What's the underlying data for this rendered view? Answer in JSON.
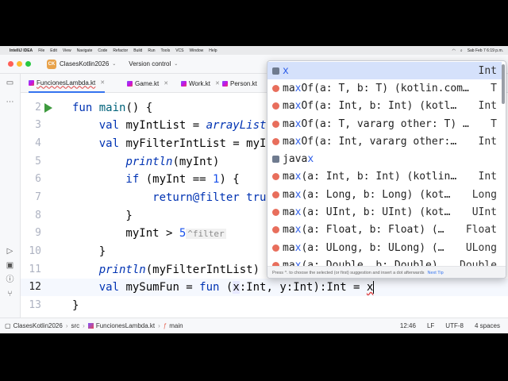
{
  "menubar": {
    "app": "IntelliJ IDEA",
    "items": [
      "File",
      "Edit",
      "View",
      "Navigate",
      "Code",
      "Refactor",
      "Build",
      "Run",
      "Tools",
      "VCS",
      "Window",
      "Help"
    ],
    "clock": "Sab Feb 7  6:19 p.m."
  },
  "titlebar": {
    "project_badge": "CK",
    "project_name": "ClasesKotlin2026",
    "version_control": "Version control"
  },
  "tabs": [
    {
      "label": "FuncionesLambda.kt",
      "active": true
    },
    {
      "label": "Game.kt",
      "active": false
    },
    {
      "label": "Work.kt",
      "active": false
    },
    {
      "label": "Person.kt",
      "active": false
    }
  ],
  "editor": {
    "line_numbers": [
      "2",
      "3",
      "4",
      "5",
      "6",
      "7",
      "8",
      "9",
      "10",
      "11",
      "12",
      "13"
    ],
    "current_line": "12",
    "lines": {
      "l2_a": "fun ",
      "l2_b": "main",
      "l2_c": "() {",
      "l3_a": "    val ",
      "l3_b": "myIntList = ",
      "l3_c": "arrayList",
      "l4_a": "    val ",
      "l4_b": "myFilterIntList = myI",
      "l5_a": "        ",
      "l5_b": "println",
      "l5_c": "(myInt)",
      "l6_a": "        if ",
      "l6_b": "(myInt == ",
      "l6_c": "1",
      "l6_d": ") {",
      "l7_a": "            return",
      "l7_b": "@filter",
      "l7_c": " tru",
      "l8_a": "        }",
      "l9_a": "        myInt > ",
      "l9_b": "5",
      "l9_hint": "^filter",
      "l10_a": "    }",
      "l11_a": "    ",
      "l11_b": "println",
      "l11_c": "(myFilterIntList)",
      "l12_a": "    val ",
      "l12_b": "mySumFun = ",
      "l12_c": "fun ",
      "l12_d": "(",
      "l12_e": "x",
      "l12_f": ":Int, ",
      "l12_g": "y",
      "l12_h": ":Int):Int = ",
      "l12_i": "x",
      "l13_a": "}"
    }
  },
  "autocomplete": {
    "items": [
      {
        "icon": "p",
        "pre": "",
        "hl": "x",
        "post": "",
        "type": "Int",
        "selected": true
      },
      {
        "icon": "m",
        "pre": "ma",
        "hl": "x",
        "post": "Of(a: T, b: T) (kotlin.com…",
        "type": "T"
      },
      {
        "icon": "m",
        "pre": "ma",
        "hl": "x",
        "post": "Of(a: Int, b: Int) (kotl…",
        "type": "Int"
      },
      {
        "icon": "m",
        "pre": "ma",
        "hl": "x",
        "post": "Of(a: T, vararg other: T) …",
        "type": "T"
      },
      {
        "icon": "m",
        "pre": "ma",
        "hl": "x",
        "post": "Of(a: Int, vararg other:…",
        "type": "Int"
      },
      {
        "icon": "p",
        "pre": "java",
        "hl": "x",
        "post": "",
        "type": ""
      },
      {
        "icon": "m",
        "pre": "ma",
        "hl": "x",
        "post": "(a: Int, b: Int) (kotlin…",
        "type": "Int"
      },
      {
        "icon": "m",
        "pre": "ma",
        "hl": "x",
        "post": "(a: Long, b: Long) (kot…",
        "type": "Long"
      },
      {
        "icon": "m",
        "pre": "ma",
        "hl": "x",
        "post": "(a: UInt, b: UInt) (kot…",
        "type": "UInt"
      },
      {
        "icon": "m",
        "pre": "ma",
        "hl": "x",
        "post": "(a: Float, b: Float) (…",
        "type": "Float"
      },
      {
        "icon": "m",
        "pre": "ma",
        "hl": "x",
        "post": "(a: ULong, b: ULong) (…",
        "type": "ULong"
      },
      {
        "icon": "m",
        "pre": "ma",
        "hl": "x",
        "post": "(a: Double, b: Double) …",
        "type": "Double"
      }
    ],
    "footer_text": "Press ^. to choose the selected (or first) suggestion and insert a dot afterwards",
    "footer_tip": "Next Tip"
  },
  "statusbar": {
    "crumbs": [
      "ClasesKotlin2026",
      "src",
      "FuncionesLambda.kt",
      "main"
    ],
    "position": "12:46",
    "line_sep": "LF",
    "encoding": "UTF-8",
    "indent": "4 spaces"
  },
  "colors": {
    "accent": "#3574f0",
    "run": "#3e9a3e",
    "keyword": "#0033b3"
  }
}
